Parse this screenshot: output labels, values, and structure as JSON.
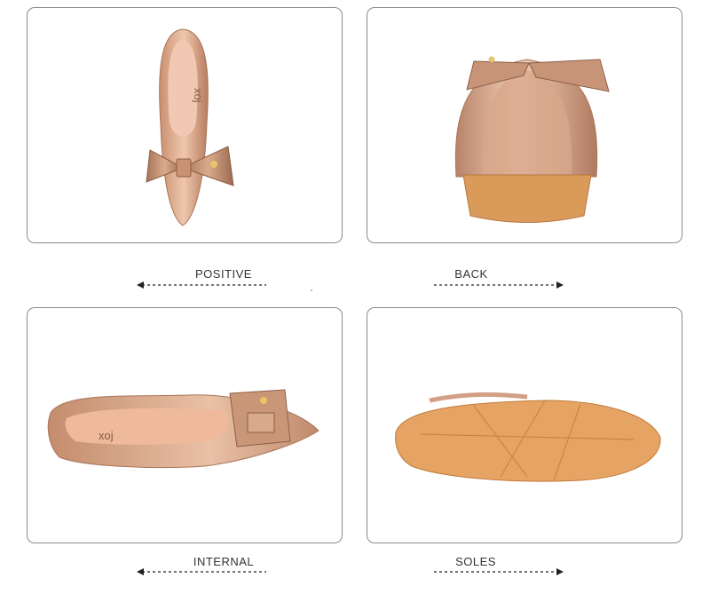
{
  "panels": [
    {
      "id": "positive",
      "label": "POSITIVE",
      "arrow": "left",
      "insole_brand": "xoj"
    },
    {
      "id": "back",
      "label": "BACK",
      "arrow": "right"
    },
    {
      "id": "internal",
      "label": "INTERNAL",
      "arrow": "left",
      "insole_brand": "xoj"
    },
    {
      "id": "soles",
      "label": "SOLES",
      "arrow": "right"
    }
  ],
  "colors": {
    "border": "#8a8a8a",
    "leather": "#d9a98c",
    "sole": "#e0a261",
    "text": "#333333"
  }
}
